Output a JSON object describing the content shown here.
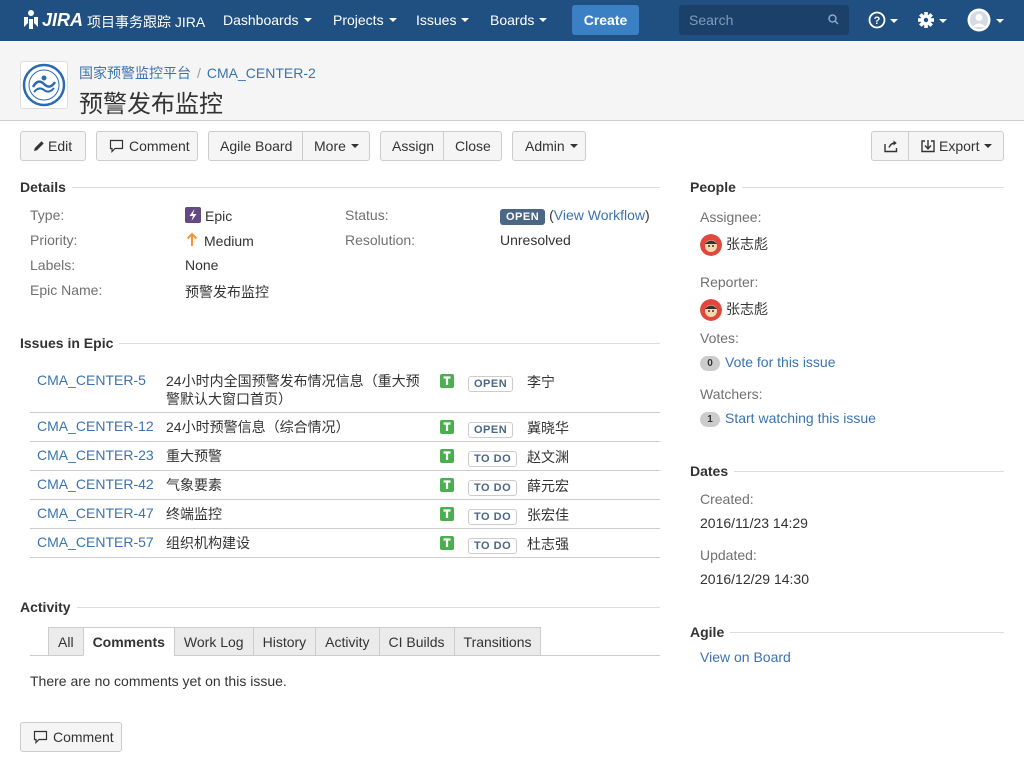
{
  "nav": {
    "logo_text": "JIRA",
    "app_name": "项目事务跟踪 JIRA",
    "dashboards": "Dashboards",
    "projects": "Projects",
    "issues": "Issues",
    "boards": "Boards",
    "create": "Create",
    "search_placeholder": "Search"
  },
  "header": {
    "project": "国家预警监控平台",
    "issue_key": "CMA_CENTER-2",
    "title": "预警发布监控"
  },
  "toolbar": {
    "edit": "Edit",
    "comment": "Comment",
    "agile_board": "Agile Board",
    "more": "More",
    "assign": "Assign",
    "close": "Close",
    "admin": "Admin",
    "export": "Export"
  },
  "details": {
    "section": "Details",
    "type_label": "Type:",
    "type_value": "Epic",
    "priority_label": "Priority:",
    "priority_value": "Medium",
    "labels_label": "Labels:",
    "labels_value": "None",
    "epic_name_label": "Epic Name:",
    "epic_name_value": "预警发布监控",
    "status_label": "Status:",
    "status_value": "OPEN",
    "view_workflow": "View Workflow",
    "resolution_label": "Resolution:",
    "resolution_value": "Unresolved"
  },
  "issues_in_epic": {
    "section": "Issues in Epic",
    "rows": [
      {
        "key": "CMA_CENTER-5",
        "summary": "24小时内全国预警发布情况信息（重大预警默认大窗口首页）",
        "status": "OPEN",
        "assignee": "李宁"
      },
      {
        "key": "CMA_CENTER-12",
        "summary": "24小时预警信息（综合情况）",
        "status": "OPEN",
        "assignee": "冀晓华"
      },
      {
        "key": "CMA_CENTER-23",
        "summary": "重大预警",
        "status": "TO DO",
        "assignee": "赵文渊"
      },
      {
        "key": "CMA_CENTER-42",
        "summary": "气象要素",
        "status": "TO DO",
        "assignee": "薛元宏"
      },
      {
        "key": "CMA_CENTER-47",
        "summary": "终端监控",
        "status": "TO DO",
        "assignee": "张宏佳"
      },
      {
        "key": "CMA_CENTER-57",
        "summary": "组织机构建设",
        "status": "TO DO",
        "assignee": "杜志强"
      }
    ]
  },
  "activity": {
    "section": "Activity",
    "tabs": [
      "All",
      "Comments",
      "Work Log",
      "History",
      "Activity",
      "CI Builds",
      "Transitions"
    ],
    "empty_text": "There are no comments yet on this issue.",
    "comment_button": "Comment"
  },
  "people": {
    "section": "People",
    "assignee_label": "Assignee:",
    "assignee": "张志彪",
    "reporter_label": "Reporter:",
    "reporter": "张志彪",
    "votes_label": "Votes:",
    "votes_count": "0",
    "vote_link": "Vote for this issue",
    "watchers_label": "Watchers:",
    "watchers_count": "1",
    "watch_link": "Start watching this issue"
  },
  "dates": {
    "section": "Dates",
    "created_label": "Created:",
    "created": "2016/11/23 14:29",
    "updated_label": "Updated:",
    "updated": "2016/12/29 14:30"
  },
  "agile": {
    "section": "Agile",
    "view_on_board": "View on Board"
  },
  "colors": {
    "nav_bg": "#205081",
    "create_bg": "#3b7fc4",
    "link": "#3b73af",
    "epic_purple": "#654982",
    "priority_orange": "#f79232",
    "task_green": "#4bae4f"
  }
}
